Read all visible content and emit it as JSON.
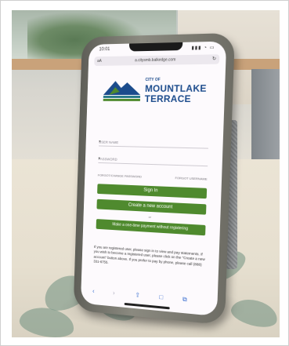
{
  "status": {
    "time": "10:01",
    "icons": "▮▮▮ ◔ ▭"
  },
  "browser": {
    "aa_label": "aA",
    "url": "a.citysmb.balkedge.com",
    "reload_icon": "↻"
  },
  "logo": {
    "small": "CITY OF",
    "line1": "MOUNTLAKE",
    "line2": "TERRACE",
    "colors": {
      "navy": "#1b4b8c",
      "green": "#4f8a2e",
      "teal": "#2a7a8a"
    }
  },
  "form": {
    "username_placeholder": "USER NAME",
    "password_placeholder": "PASSWORD",
    "caret": "▾",
    "forgot_password": "FORGOT/CHANGE PASSWORD",
    "forgot_username": "FORGOT USERNAME"
  },
  "buttons": {
    "sign_in": "Sign In",
    "create_account": "Create a new account",
    "one_time_payment": "Make a one-time payment without registering",
    "or": "or"
  },
  "info_text": "If you are registered user, please sign in to view and pay statements. If you wish to become a registered user, please click on the \"Create a new account\" button above. If you prefer to pay by phone, please call (888) 331-6755.",
  "toolbar": {
    "back": "‹",
    "forward": "›",
    "share": "⇪",
    "books": "□",
    "tabs": "⧉"
  }
}
